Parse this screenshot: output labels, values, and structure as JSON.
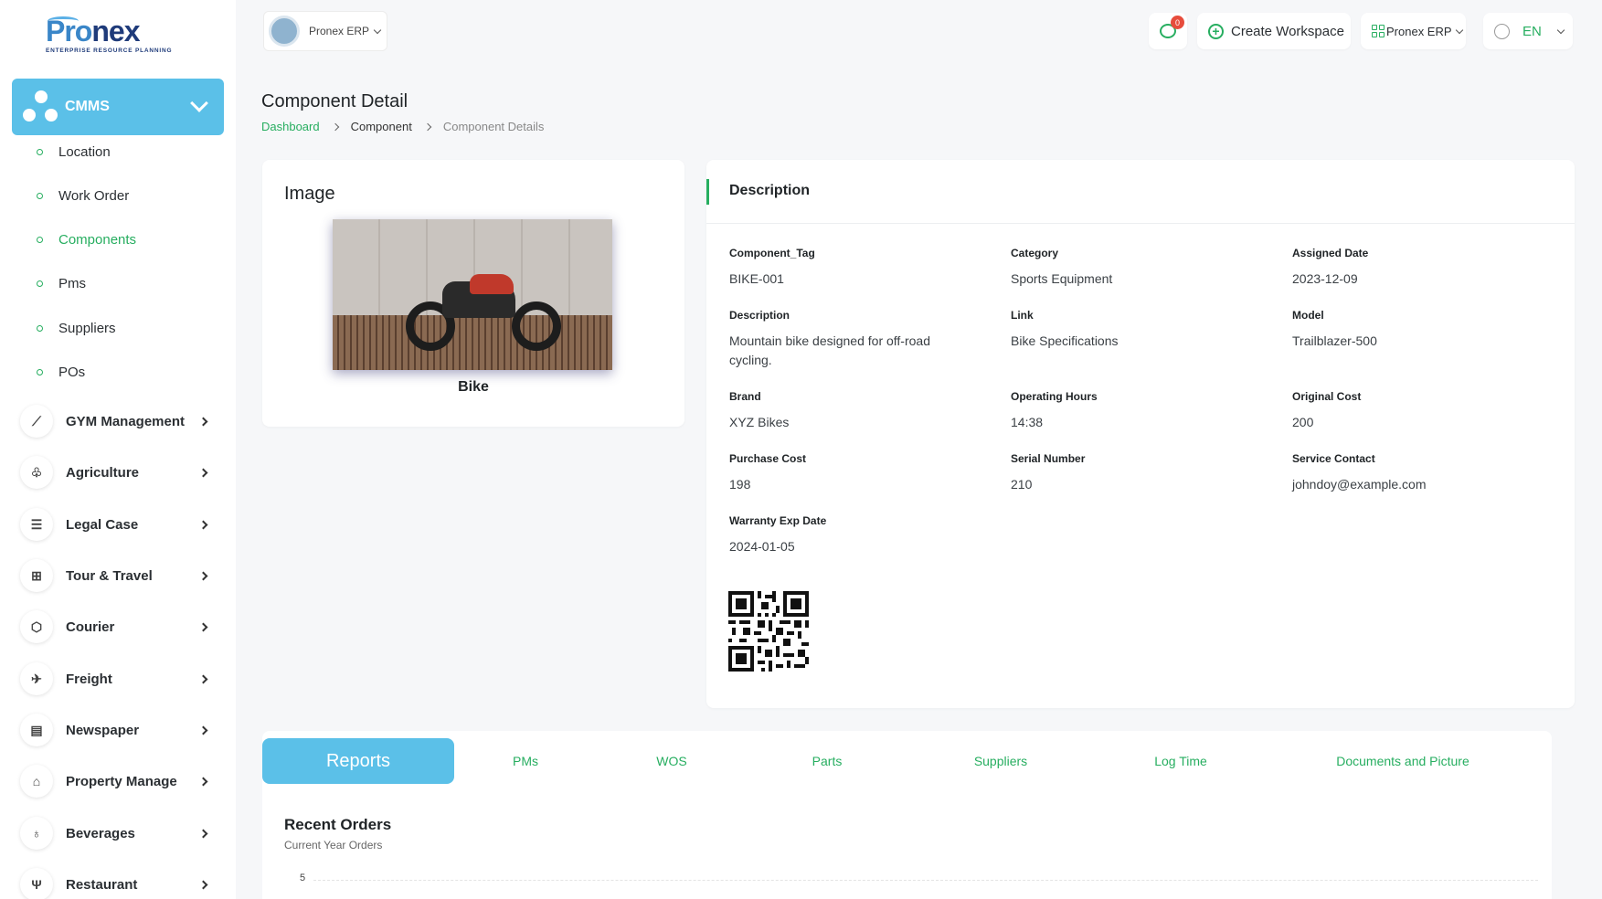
{
  "brand": {
    "logo_text_1": "Pro",
    "logo_text_2": "nex",
    "tagline": "ENTERPRISE RESOURCE PLANNING"
  },
  "sidebar": {
    "active_module": "CMMS",
    "cmms_items": [
      {
        "label": "Location",
        "active": false
      },
      {
        "label": "Work Order",
        "active": false
      },
      {
        "label": "Components",
        "active": true
      },
      {
        "label": "Pms",
        "active": false
      },
      {
        "label": "Suppliers",
        "active": false
      },
      {
        "label": "POs",
        "active": false
      }
    ],
    "modules": [
      {
        "label": "GYM Management",
        "icon": "dumbbell-icon"
      },
      {
        "label": "Agriculture",
        "icon": "plant-icon"
      },
      {
        "label": "Legal Case",
        "icon": "checklist-icon"
      },
      {
        "label": "Tour & Travel",
        "icon": "apps-icon"
      },
      {
        "label": "Courier",
        "icon": "box-icon"
      },
      {
        "label": "Freight",
        "icon": "plane-icon"
      },
      {
        "label": "Newspaper",
        "icon": "newspaper-icon"
      },
      {
        "label": "Property Manage",
        "icon": "building-icon"
      },
      {
        "label": "Beverages",
        "icon": "glass-icon"
      },
      {
        "label": "Restaurant",
        "icon": "cutlery-icon"
      }
    ]
  },
  "topbar": {
    "org_name": "Pronex ERP",
    "notification_count": "0",
    "create_workspace": "Create Workspace",
    "erp_switch": "Pronex ERP",
    "language": "EN"
  },
  "page": {
    "title": "Component Detail",
    "breadcrumb": [
      "Dashboard",
      "Component",
      "Component Details"
    ]
  },
  "image_card": {
    "title": "Image",
    "caption": "Bike"
  },
  "description_card": {
    "title": "Description",
    "fields": [
      {
        "key": "Component_Tag",
        "value": "BIKE-001"
      },
      {
        "key": "Category",
        "value": "Sports Equipment"
      },
      {
        "key": "Assigned Date",
        "value": "2023-12-09"
      },
      {
        "key": "Description",
        "value": "Mountain bike designed for off-road cycling."
      },
      {
        "key": "Link",
        "value": "Bike Specifications"
      },
      {
        "key": "Model",
        "value": "Trailblazer-500"
      },
      {
        "key": "Brand",
        "value": "XYZ Bikes"
      },
      {
        "key": "Operating Hours",
        "value": "14:38"
      },
      {
        "key": "Original Cost",
        "value": "200"
      },
      {
        "key": "Purchase Cost",
        "value": "198"
      },
      {
        "key": "Serial Number",
        "value": "210"
      },
      {
        "key": "Service Contact",
        "value": "johndoy@example.com"
      },
      {
        "key": "Warranty Exp Date",
        "value": "2024-01-05"
      }
    ]
  },
  "tabs": {
    "items": [
      "Reports",
      "PMs",
      "WOS",
      "Parts",
      "Suppliers",
      "Log Time",
      "Documents and Picture"
    ],
    "active": "Reports"
  },
  "report": {
    "title": "Recent Orders",
    "subtitle": "Current Year Orders",
    "y_tick": "5"
  },
  "colors": {
    "accent": "#27ae60",
    "primary": "#5bc0e8",
    "badge": "#e74c3c"
  }
}
